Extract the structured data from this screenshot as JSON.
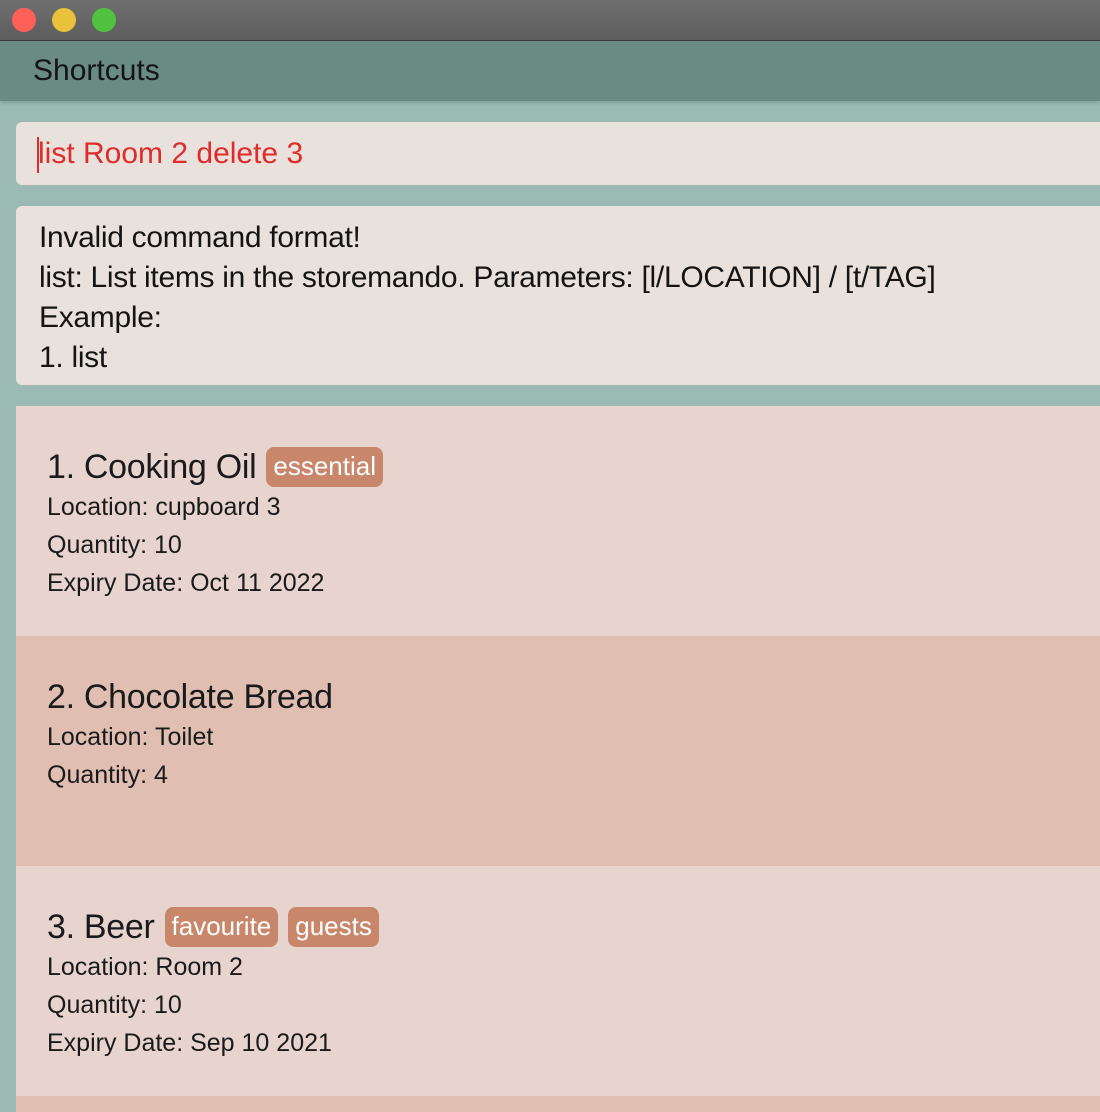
{
  "window": {
    "controls": [
      "close",
      "minimize",
      "maximize"
    ]
  },
  "menubar": {
    "items": [
      {
        "label": "Shortcuts"
      }
    ]
  },
  "command": {
    "value": "list Room 2 delete 3",
    "text_color": "#e02b2b"
  },
  "result": {
    "lines": [
      "Invalid command format!",
      "list: List items in the storemando. Parameters: [l/LOCATION] / [t/TAG]",
      "Example:",
      "1. list"
    ]
  },
  "items": [
    {
      "title": "1. Cooking Oil",
      "tags": [
        "essential"
      ],
      "details": [
        "Location: cupboard 3",
        "Quantity: 10",
        "Expiry Date: Oct 11 2022"
      ]
    },
    {
      "title": "2. Chocolate Bread",
      "tags": [],
      "details": [
        "Location: Toilet",
        "Quantity: 4"
      ]
    },
    {
      "title": "3. Beer",
      "tags": [
        "favourite",
        "guests"
      ],
      "details": [
        "Location: Room 2",
        "Quantity: 10",
        "Expiry Date: Sep 10 2021"
      ]
    }
  ],
  "colors": {
    "background": "#9bbab3",
    "menubar": "#6a8b83",
    "panel": "#e9e2dc",
    "card_odd": "#e8d4ce",
    "card_even": "#e0beb2",
    "tag": "#c8876b"
  }
}
